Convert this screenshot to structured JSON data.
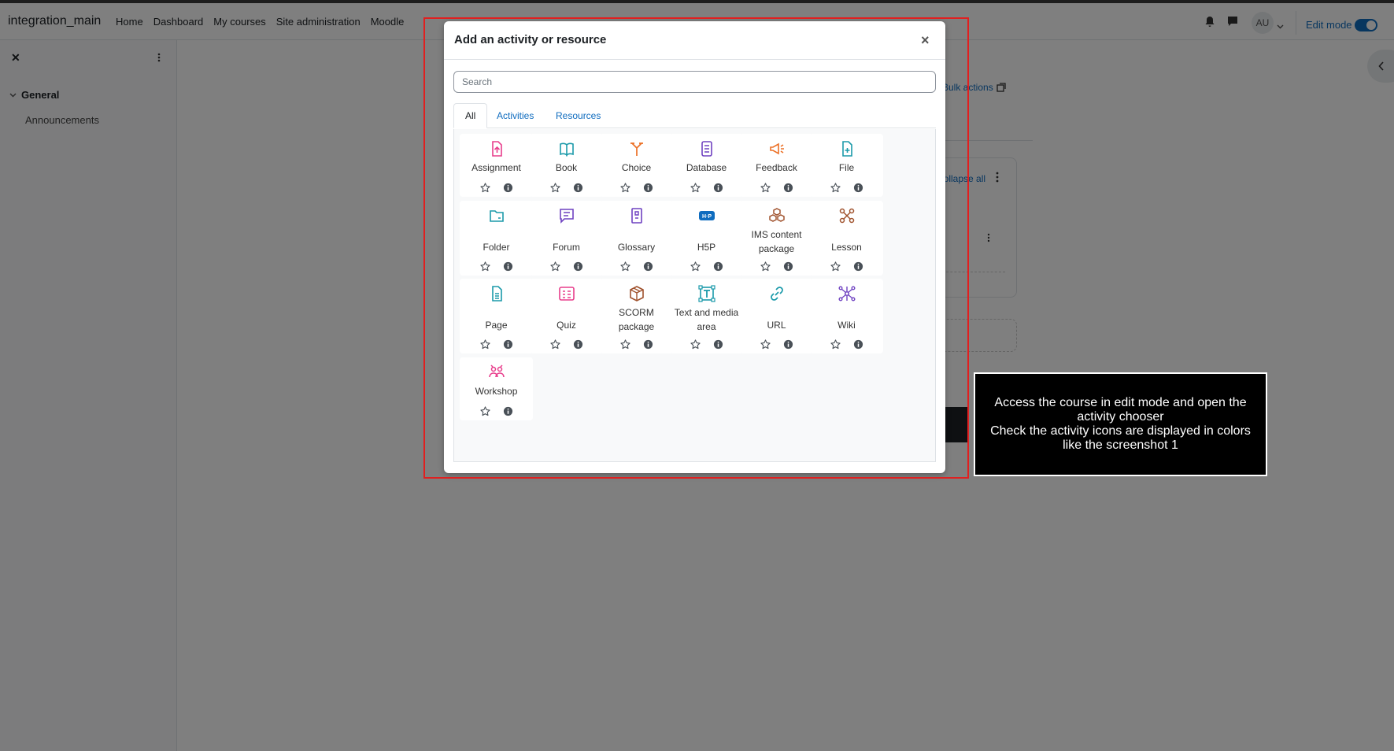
{
  "navbar": {
    "site_name": "integration_main",
    "links": [
      "Home",
      "Dashboard",
      "My courses",
      "Site administration",
      "Moodle"
    ],
    "avatar_initials": "AU",
    "edit_mode_label": "Edit mode"
  },
  "drawer": {
    "section": "General",
    "items": [
      "Announcements"
    ]
  },
  "background": {
    "bulk_actions": "Bulk actions",
    "collapse_all": "Collapse all"
  },
  "modal": {
    "title": "Add an activity or resource",
    "search_placeholder": "Search",
    "tabs": [
      "All",
      "Activities",
      "Resources"
    ],
    "activities": [
      {
        "label": "Assignment",
        "icon": "assignment-icon",
        "color": "#e83e8c"
      },
      {
        "label": "Book",
        "icon": "book-icon",
        "color": "#1b9aaa"
      },
      {
        "label": "Choice",
        "icon": "choice-icon",
        "color": "#ec7026"
      },
      {
        "label": "Database",
        "icon": "database-icon",
        "color": "#6f42c1"
      },
      {
        "label": "Feedback",
        "icon": "feedback-icon",
        "color": "#ec7026"
      },
      {
        "label": "File",
        "icon": "file-icon",
        "color": "#1b9aaa"
      },
      {
        "label": "Folder",
        "icon": "folder-icon",
        "color": "#1b9aaa"
      },
      {
        "label": "Forum",
        "icon": "forum-icon",
        "color": "#6f42c1"
      },
      {
        "label": "Glossary",
        "icon": "glossary-icon",
        "color": "#6f42c1"
      },
      {
        "label": "H5P",
        "icon": "h5p-icon",
        "color": "#0f6cbf"
      },
      {
        "label": "IMS content package",
        "icon": "ims-package-icon",
        "color": "#a0522d"
      },
      {
        "label": "Lesson",
        "icon": "lesson-icon",
        "color": "#a0522d"
      },
      {
        "label": "Page",
        "icon": "page-icon",
        "color": "#1b9aaa"
      },
      {
        "label": "Quiz",
        "icon": "quiz-icon",
        "color": "#e83e8c"
      },
      {
        "label": "SCORM package",
        "icon": "scorm-icon",
        "color": "#a0522d"
      },
      {
        "label": "Text and media area",
        "icon": "text-media-icon",
        "color": "#1b9aaa"
      },
      {
        "label": "URL",
        "icon": "url-icon",
        "color": "#1b9aaa"
      },
      {
        "label": "Wiki",
        "icon": "wiki-icon",
        "color": "#6f42c1"
      },
      {
        "label": "Workshop",
        "icon": "workshop-icon",
        "color": "#e83e8c"
      }
    ]
  },
  "annotation": {
    "text": "Access the course in edit mode and open the activity chooser\nCheck the activity icons are displayed in colors like the screenshot 1"
  }
}
